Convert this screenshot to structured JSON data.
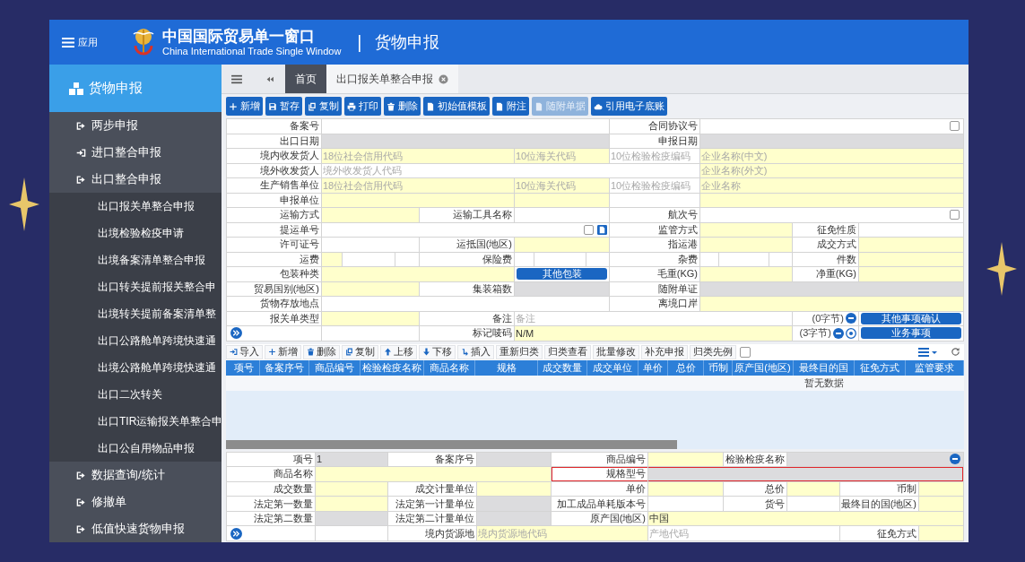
{
  "header": {
    "menu_label": "应用",
    "title": "中国国际贸易单一窗口",
    "subtitle": "China International Trade Single Window",
    "separator": "|",
    "section": "货物申报"
  },
  "sidebar": {
    "heading": "货物申报",
    "items": [
      {
        "label": "两步申报"
      },
      {
        "label": "进口整合申报"
      },
      {
        "label": "出口整合申报",
        "children": [
          {
            "label": "出口报关单整合申报"
          },
          {
            "label": "出境检验检疫申请"
          },
          {
            "label": "出境备案清单整合申报"
          },
          {
            "label": "出口转关提前报关整合申"
          },
          {
            "label": "出境转关提前备案清单整"
          },
          {
            "label": "出口公路舱单跨境快速通"
          },
          {
            "label": "出境公路舱单跨境快速通"
          },
          {
            "label": "出口二次转关"
          },
          {
            "label": "出口TIR运输报关单整合申"
          },
          {
            "label": "出口公自用物品申报"
          }
        ]
      },
      {
        "label": "数据查询/统计"
      },
      {
        "label": "修撤单"
      },
      {
        "label": "低值快速货物申报"
      }
    ]
  },
  "tabs": [
    {
      "label": "首页",
      "selected": false
    },
    {
      "label": "出口报关单整合申报",
      "selected": true
    }
  ],
  "toolbar": [
    {
      "label": "新增",
      "disabled": false
    },
    {
      "label": "暂存",
      "disabled": false
    },
    {
      "label": "复制",
      "disabled": false
    },
    {
      "label": "打印",
      "disabled": false
    },
    {
      "label": "删除",
      "disabled": false
    },
    {
      "label": "初始值模板",
      "disabled": false
    },
    {
      "label": "附注",
      "disabled": false
    },
    {
      "label": "随附单据",
      "disabled": true
    },
    {
      "label": "引用电子底账",
      "disabled": false
    }
  ],
  "declaration_form": {
    "lines": [
      [
        {
          "kind": "label",
          "text": "备案号"
        },
        {
          "kind": "optional"
        },
        {
          "kind": "label",
          "text": "合同协议号"
        },
        {
          "kind": "optional",
          "checked": false
        }
      ],
      [
        {
          "kind": "label",
          "text": "出口日期"
        },
        {
          "kind": "readonly"
        },
        {
          "kind": "label",
          "text": "申报日期"
        },
        {
          "kind": "readonly"
        }
      ],
      [
        {
          "kind": "label",
          "text": "境内收发货人"
        },
        {
          "kind": "required",
          "placeholder": "18位社会信用代码"
        },
        {
          "kind": "required",
          "placeholder": "10位海关代码"
        },
        {
          "kind": "optional",
          "placeholder": "10位检验检疫编码"
        },
        {
          "kind": "required",
          "placeholder": "企业名称(中文)"
        }
      ],
      [
        {
          "kind": "label",
          "text": "境外收发货人"
        },
        {
          "kind": "optional",
          "placeholder": "境外收发货人代码"
        },
        {
          "kind": "required",
          "placeholder": "企业名称(外文)"
        }
      ],
      [
        {
          "kind": "label",
          "text": "生产销售单位"
        },
        {
          "kind": "required",
          "placeholder": "18位社会信用代码"
        },
        {
          "kind": "required",
          "placeholder": "10位海关代码"
        },
        {
          "kind": "optional",
          "placeholder": "10位检验检疫编码"
        },
        {
          "kind": "required",
          "placeholder": "企业名称"
        }
      ],
      [
        {
          "kind": "label",
          "text": "申报单位"
        },
        {
          "kind": "required"
        },
        {
          "kind": "required"
        },
        {
          "kind": "optional"
        },
        {
          "kind": "required"
        }
      ],
      [
        {
          "kind": "label",
          "text": "运输方式"
        },
        {
          "kind": "required"
        },
        {
          "kind": "label",
          "text": "运输工具名称"
        },
        {
          "kind": "optional"
        },
        {
          "kind": "label",
          "text": "航次号"
        },
        {
          "kind": "optional",
          "checked": false
        }
      ],
      [
        {
          "kind": "label",
          "text": "提运单号"
        },
        {
          "kind": "optional",
          "checked": false
        },
        {
          "kind": "label",
          "text": "监管方式"
        },
        {
          "kind": "required"
        },
        {
          "kind": "label",
          "text": "征免性质"
        },
        {
          "kind": "optional"
        }
      ],
      [
        {
          "kind": "label",
          "text": "许可证号"
        },
        {
          "kind": "optional"
        },
        {
          "kind": "label",
          "text": "运抵国(地区)"
        },
        {
          "kind": "required"
        },
        {
          "kind": "label",
          "text": "指运港"
        },
        {
          "kind": "required"
        },
        {
          "kind": "label",
          "text": "成交方式"
        },
        {
          "kind": "required"
        }
      ],
      [
        {
          "kind": "label",
          "text": "运费"
        },
        {
          "kind": "split",
          "parts": [
            {
              "kind": "required"
            },
            {
              "kind": "optional"
            },
            {
              "kind": "optional"
            }
          ]
        },
        {
          "kind": "label",
          "text": "保险费"
        },
        {
          "kind": "split",
          "parts": [
            {
              "kind": "optional"
            },
            {
              "kind": "optional"
            },
            {
              "kind": "optional"
            }
          ]
        },
        {
          "kind": "label",
          "text": "杂费"
        },
        {
          "kind": "split",
          "parts": [
            {
              "kind": "optional"
            },
            {
              "kind": "optional"
            },
            {
              "kind": "optional"
            }
          ]
        },
        {
          "kind": "label",
          "text": "件数"
        },
        {
          "kind": "required"
        }
      ],
      [
        {
          "kind": "label",
          "text": "包装种类"
        },
        {
          "kind": "required"
        },
        {
          "kind": "button",
          "text": "其他包装"
        },
        {
          "kind": "label",
          "text": "毛重(KG)"
        },
        {
          "kind": "required"
        },
        {
          "kind": "label",
          "text": "净重(KG)"
        },
        {
          "kind": "required"
        }
      ],
      [
        {
          "kind": "label",
          "text": "贸易国别(地区)"
        },
        {
          "kind": "required"
        },
        {
          "kind": "label",
          "text": "集装箱数"
        },
        {
          "kind": "readonly"
        },
        {
          "kind": "label",
          "text": "随附单证"
        },
        {
          "kind": "readonly"
        }
      ],
      [
        {
          "kind": "label",
          "text": "货物存放地点"
        },
        {
          "kind": "optional"
        },
        {
          "kind": "label",
          "text": "离境口岸"
        },
        {
          "kind": "required"
        }
      ],
      [
        {
          "kind": "label",
          "text": "报关单类型"
        },
        {
          "kind": "required"
        },
        {
          "kind": "label",
          "text": "备注"
        },
        {
          "kind": "optional",
          "placeholder": "备注"
        },
        {
          "kind": "counter",
          "text": "(0字节)"
        },
        {
          "kind": "button",
          "text": "其他事项确认"
        }
      ],
      [
        {
          "kind": "expander"
        },
        {
          "kind": "optional"
        },
        {
          "kind": "label",
          "text": "标记唛码"
        },
        {
          "kind": "required",
          "value": "N/M"
        },
        {
          "kind": "counter",
          "text": "(3字节)"
        },
        {
          "kind": "button",
          "text": "业务事项"
        }
      ]
    ]
  },
  "goods_toolbar": {
    "buttons": [
      "导入",
      "新增",
      "删除",
      "复制",
      "上移",
      "下移",
      "插入",
      "重新归类",
      "归类查看",
      "批量修改",
      "补充申报",
      "归类先例"
    ],
    "checkbox": {
      "checked": false
    }
  },
  "goods_table": {
    "columns": [
      "项号",
      "备案序号",
      "商品编号",
      "检验检疫名称",
      "商品名称",
      "规格",
      "成交数量",
      "成交单位",
      "单价",
      "总价",
      "币制",
      "原产国(地区)",
      "最终目的国",
      "征免方式",
      "监管要求"
    ],
    "empty_text": "暂无数据"
  },
  "goods_form": {
    "lines": [
      [
        {
          "kind": "label",
          "text": "项号"
        },
        {
          "kind": "readonly",
          "value": "1"
        },
        {
          "kind": "label",
          "text": "备案序号"
        },
        {
          "kind": "readonly"
        },
        {
          "kind": "label",
          "text": "商品编号"
        },
        {
          "kind": "required"
        },
        {
          "kind": "label",
          "text": "检验检疫名称"
        },
        {
          "kind": "readonly"
        }
      ],
      [
        {
          "kind": "label",
          "text": "商品名称"
        },
        {
          "kind": "required"
        },
        {
          "kind": "label",
          "text": "规格型号",
          "highlighted": true
        },
        {
          "kind": "readonly",
          "highlighted": true
        }
      ],
      [
        {
          "kind": "label",
          "text": "成交数量"
        },
        {
          "kind": "required"
        },
        {
          "kind": "label",
          "text": "成交计量单位"
        },
        {
          "kind": "required"
        },
        {
          "kind": "label",
          "text": "单价"
        },
        {
          "kind": "required"
        },
        {
          "kind": "label",
          "text": "总价"
        },
        {
          "kind": "required"
        },
        {
          "kind": "label",
          "text": "币制"
        },
        {
          "kind": "required"
        }
      ],
      [
        {
          "kind": "label",
          "text": "法定第一数量"
        },
        {
          "kind": "required"
        },
        {
          "kind": "label",
          "text": "法定第一计量单位"
        },
        {
          "kind": "readonly"
        },
        {
          "kind": "label",
          "text": "加工成品单耗版本号"
        },
        {
          "kind": "optional"
        },
        {
          "kind": "label",
          "text": "货号"
        },
        {
          "kind": "optional"
        },
        {
          "kind": "label",
          "text": "最终目的国(地区)"
        },
        {
          "kind": "required"
        }
      ],
      [
        {
          "kind": "label",
          "text": "法定第二数量"
        },
        {
          "kind": "readonly"
        },
        {
          "kind": "label",
          "text": "法定第二计量单位"
        },
        {
          "kind": "readonly"
        },
        {
          "kind": "label",
          "text": "原产国(地区)"
        },
        {
          "kind": "required",
          "value": "中国"
        }
      ],
      [
        {
          "kind": "expander"
        },
        {
          "kind": "optional"
        },
        {
          "kind": "label",
          "text": "境内货源地"
        },
        {
          "kind": "required",
          "placeholder": "境内货源地代码"
        },
        {
          "kind": "optional",
          "placeholder": "产地代码"
        },
        {
          "kind": "label",
          "text": "征免方式"
        },
        {
          "kind": "required"
        }
      ]
    ]
  }
}
